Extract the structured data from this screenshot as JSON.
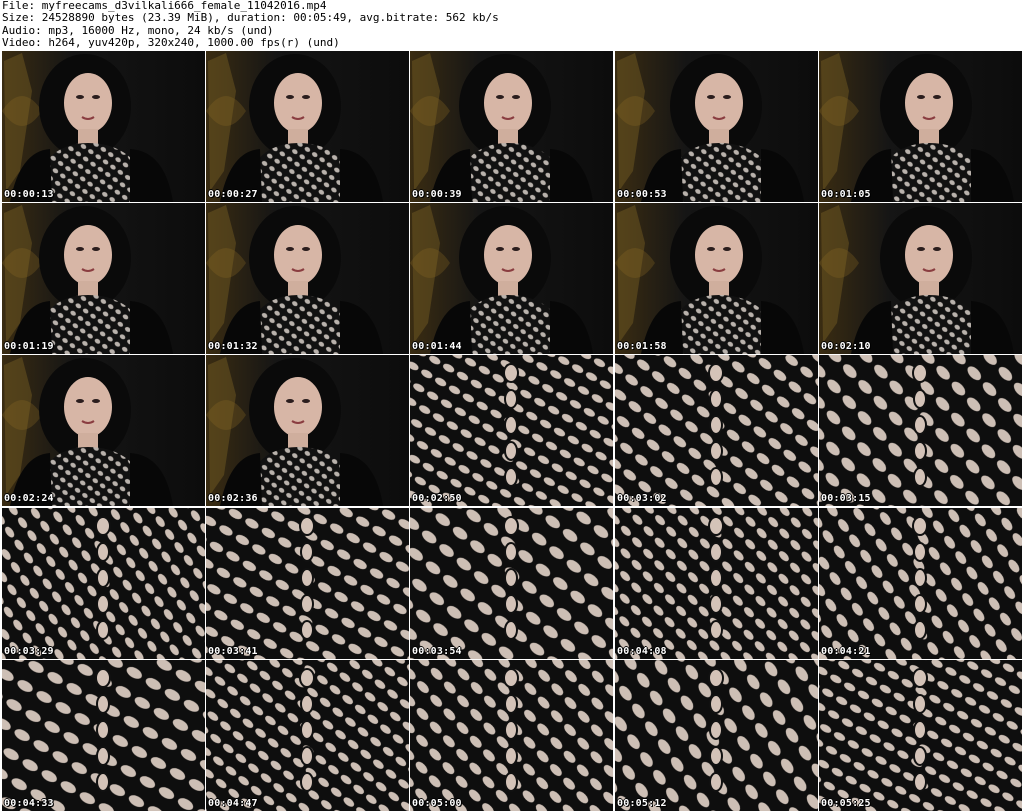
{
  "file_info": {
    "file": "File: myfreecams_d3vilkali666_female_11042016.mp4",
    "size": "Size: 24528890 bytes (23.39 MiB), duration: 00:05:49, avg.bitrate: 562 kb/s",
    "audio": "Audio: mp3, 16000 Hz, mono, 24 kb/s (und)",
    "video": "Video: h264, yuv420p, 320x240, 1000.00 fps(r) (und)"
  },
  "thumbnails": [
    {
      "timestamp": "00:00:13",
      "scene": "portrait"
    },
    {
      "timestamp": "00:00:27",
      "scene": "portrait"
    },
    {
      "timestamp": "00:00:39",
      "scene": "portrait"
    },
    {
      "timestamp": "00:00:53",
      "scene": "portrait"
    },
    {
      "timestamp": "00:01:05",
      "scene": "portrait"
    },
    {
      "timestamp": "00:01:19",
      "scene": "portrait"
    },
    {
      "timestamp": "00:01:32",
      "scene": "portrait"
    },
    {
      "timestamp": "00:01:44",
      "scene": "portrait"
    },
    {
      "timestamp": "00:01:58",
      "scene": "portrait"
    },
    {
      "timestamp": "00:02:10",
      "scene": "portrait"
    },
    {
      "timestamp": "00:02:24",
      "scene": "portrait"
    },
    {
      "timestamp": "00:02:36",
      "scene": "portrait"
    },
    {
      "timestamp": "00:02:50",
      "scene": "mesh"
    },
    {
      "timestamp": "00:03:02",
      "scene": "mesh"
    },
    {
      "timestamp": "00:03:15",
      "scene": "mesh"
    },
    {
      "timestamp": "00:03:29",
      "scene": "mesh"
    },
    {
      "timestamp": "00:03:41",
      "scene": "mesh"
    },
    {
      "timestamp": "00:03:54",
      "scene": "mesh"
    },
    {
      "timestamp": "00:04:08",
      "scene": "mesh"
    },
    {
      "timestamp": "00:04:21",
      "scene": "mesh"
    },
    {
      "timestamp": "00:04:33",
      "scene": "mesh"
    },
    {
      "timestamp": "00:04:47",
      "scene": "mesh"
    },
    {
      "timestamp": "00:05:00",
      "scene": "mesh"
    },
    {
      "timestamp": "00:05:12",
      "scene": "mesh"
    },
    {
      "timestamp": "00:05:25",
      "scene": "mesh"
    }
  ]
}
